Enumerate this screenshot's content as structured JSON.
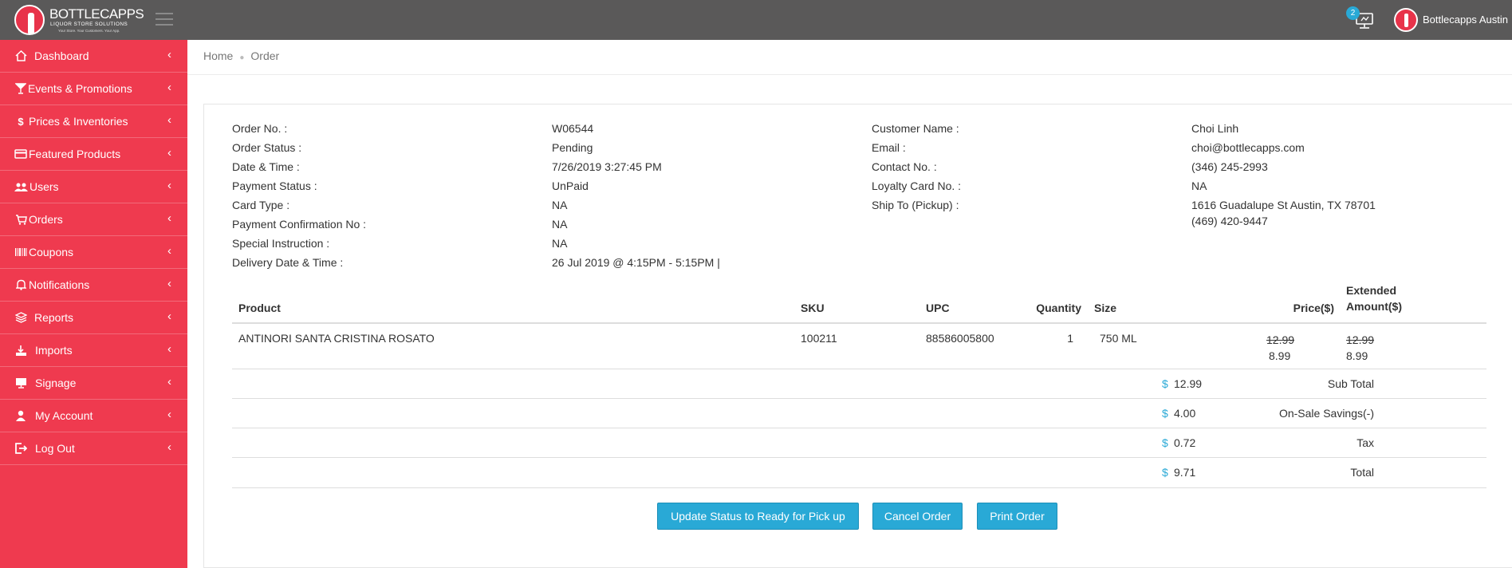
{
  "app": {
    "brand": "BOTTLECAPPS",
    "brand_sub": "LIQUOR STORE SOLUTIONS",
    "brand_tag": "Your Store. Your Customers. Your App.",
    "notification_count": "2",
    "user_name": "Bottlecapps Austin"
  },
  "sidebar": {
    "items": [
      {
        "label": "Dashboard",
        "icon": "home-icon"
      },
      {
        "label": "Events & Promotions",
        "icon": "cocktail-icon"
      },
      {
        "label": "Prices & Inventories",
        "icon": "dollar-icon"
      },
      {
        "label": "Featured Products",
        "icon": "credit-card-icon"
      },
      {
        "label": "Users",
        "icon": "users-icon"
      },
      {
        "label": "Orders",
        "icon": "cart-icon"
      },
      {
        "label": "Coupons",
        "icon": "barcode-icon"
      },
      {
        "label": "Notifications",
        "icon": "bell-icon"
      },
      {
        "label": "Reports",
        "icon": "layers-icon"
      },
      {
        "label": "Imports",
        "icon": "import-icon"
      },
      {
        "label": "Signage",
        "icon": "monitor-icon"
      },
      {
        "label": "My Account",
        "icon": "user-icon"
      },
      {
        "label": "Log Out",
        "icon": "logout-icon"
      }
    ]
  },
  "breadcrumb": {
    "home": "Home",
    "current": "Order"
  },
  "order": {
    "left": [
      {
        "label": "Order No. :",
        "value": "W06544"
      },
      {
        "label": "Order Status :",
        "value": "Pending"
      },
      {
        "label": "Date & Time :",
        "value": "7/26/2019 3:27:45 PM"
      },
      {
        "label": "Payment Status :",
        "value": "UnPaid"
      },
      {
        "label": "Card Type :",
        "value": "NA"
      },
      {
        "label": "Payment Confirmation No :",
        "value": "NA"
      },
      {
        "label": "Special Instruction :",
        "value": "NA"
      },
      {
        "label": "Delivery Date & Time :",
        "value": "26 Jul 2019 @ 4:15PM - 5:15PM |"
      }
    ],
    "right": [
      {
        "label": "Customer Name :",
        "value": "Choi Linh"
      },
      {
        "label": "Email :",
        "value": "choi@bottlecapps.com"
      },
      {
        "label": "Contact No. :",
        "value": "(346) 245-2993"
      },
      {
        "label": "Loyalty Card No. :",
        "value": "NA"
      },
      {
        "label": "Ship To (Pickup) :",
        "value": "1616 Guadalupe St  Austin, TX 78701",
        "value2": "(469) 420-9447"
      }
    ]
  },
  "table": {
    "headers": {
      "product": "Product",
      "sku": "SKU",
      "upc": "UPC",
      "quantity": "Quantity",
      "size": "Size",
      "price": "Price($)",
      "extended1": "Extended",
      "extended2": "Amount($)"
    },
    "rows": [
      {
        "product": "ANTINORI SANTA CRISTINA ROSATO",
        "sku": "100211",
        "upc": "88586005800",
        "quantity": "1",
        "size": "750 ML",
        "price_old": "12.99",
        "price_new": "8.99",
        "ext_old": "12.99",
        "ext_new": "8.99"
      }
    ]
  },
  "totals": [
    {
      "label": "Sub Total",
      "currency": "$",
      "value": "12.99"
    },
    {
      "label": "On-Sale Savings(-)",
      "currency": "$",
      "value": "4.00"
    },
    {
      "label": "Tax",
      "currency": "$",
      "value": "0.72"
    },
    {
      "label": "Total",
      "currency": "$",
      "value": "9.71"
    }
  ],
  "actions": {
    "update_status": "Update Status to Ready for Pick up",
    "cancel": "Cancel Order",
    "print": "Print Order"
  },
  "colors": {
    "topbar": "#5a5959",
    "sidebar": "#ef3a4f",
    "accent": "#29a9d6"
  }
}
